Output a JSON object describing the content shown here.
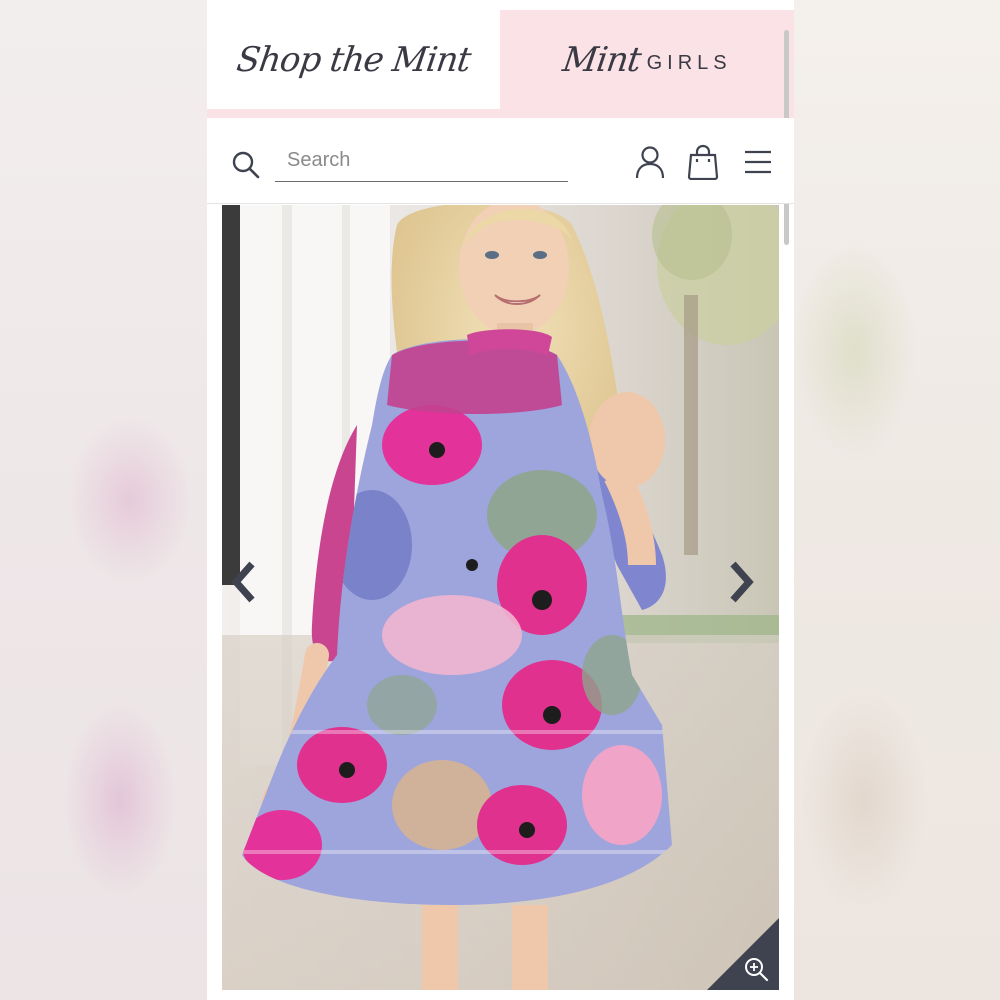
{
  "nav": {
    "shop_tab": "Shop the Mint",
    "girls_tab_script": "Mint",
    "girls_tab_word": "GIRLS"
  },
  "header": {
    "search_placeholder": "Search"
  },
  "icons": {
    "search": "search-icon",
    "account": "user-icon",
    "bag": "shopping-bag-icon",
    "menu": "hamburger-menu-icon",
    "prev": "chevron-left-icon",
    "next": "chevron-right-icon",
    "zoom": "zoom-in-icon"
  },
  "colors": {
    "brand_pink": "#fbe2e6",
    "icon_dark": "#3f4350",
    "dress_magenta": "#e0318f",
    "dress_lavender": "#8b90d6",
    "dress_sage": "#8fa58c"
  },
  "product": {
    "image_alt": "Girl wearing a magenta and lavender floral print tiered dress"
  }
}
